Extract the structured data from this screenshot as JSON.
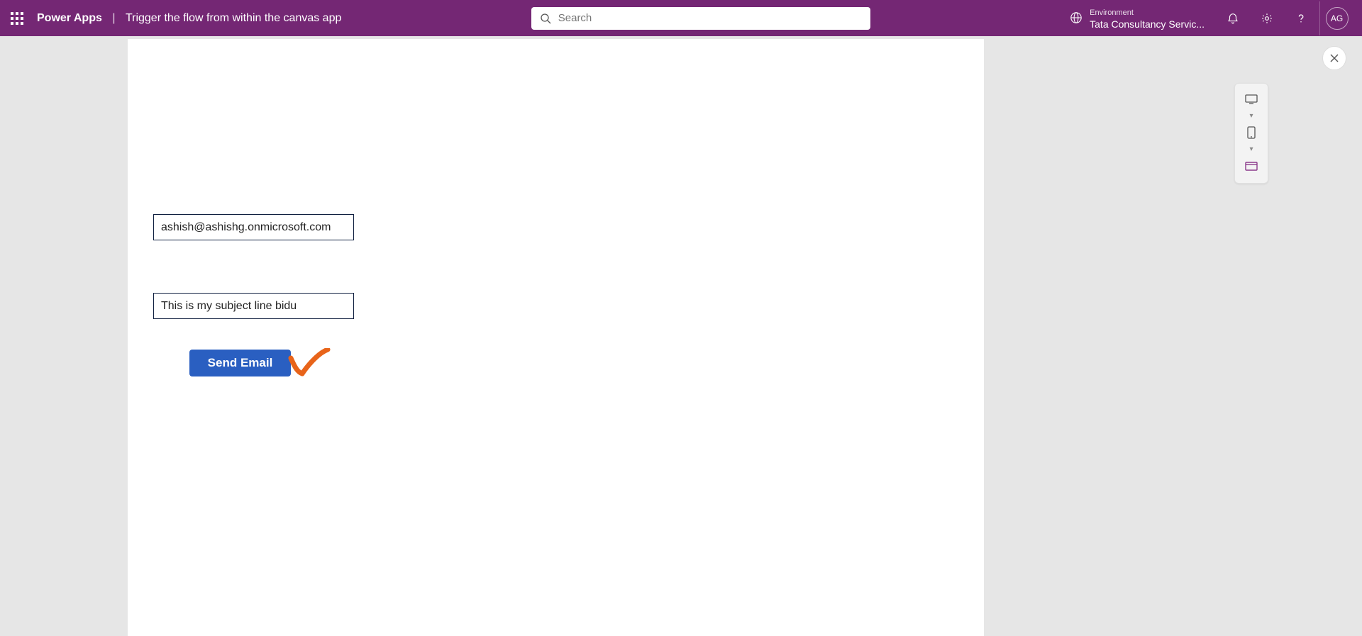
{
  "header": {
    "brand": "Power Apps",
    "separator": "|",
    "page_title": "Trigger the flow from within the canvas app",
    "search_placeholder": "Search",
    "env_label": "Environment",
    "env_name": "Tata Consultancy Servic...",
    "avatar_initials": "AG"
  },
  "form": {
    "email_value": "ashish@ashishg.onmicrosoft.com",
    "subject_value": "This is my subject line bidu",
    "send_button": "Send Email"
  }
}
